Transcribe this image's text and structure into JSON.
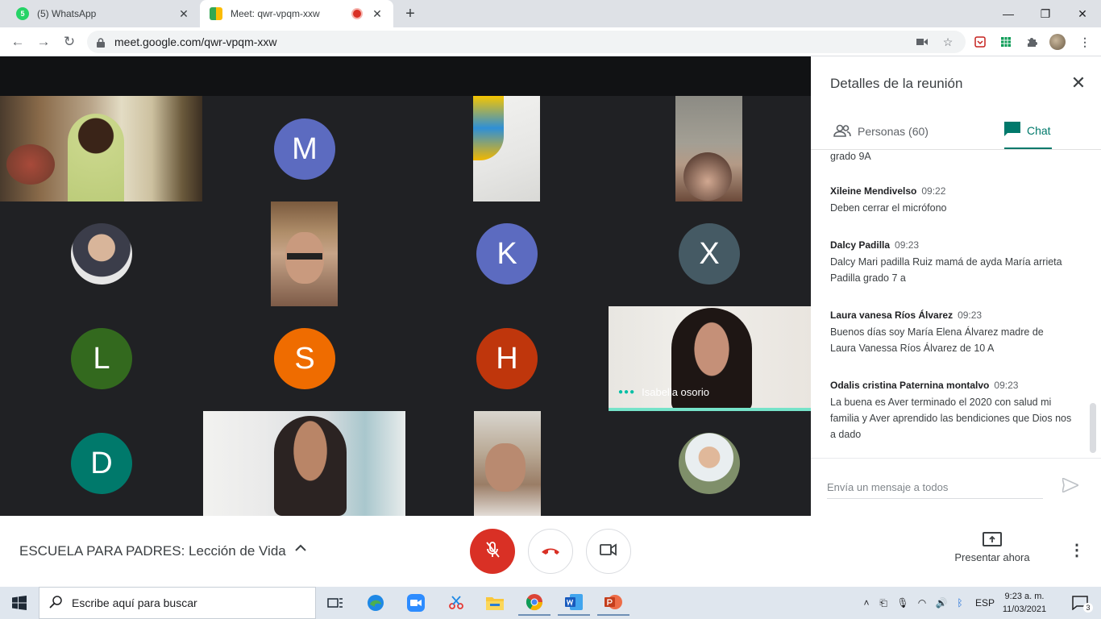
{
  "browser": {
    "tabs": [
      {
        "title": "(5) WhatsApp",
        "badge": "5",
        "active": false
      },
      {
        "title": "Meet: qwr-vpqm-xxw",
        "active": true,
        "recording": true
      }
    ],
    "url": "meet.google.com/qwr-vpqm-xxw"
  },
  "grid": {
    "tiles": [
      {
        "type": "video",
        "name": "participant-video-1"
      },
      {
        "type": "avatar",
        "letter": "M",
        "color": "#5c6bc0"
      },
      {
        "type": "video",
        "name": "participant-video-3"
      },
      {
        "type": "video",
        "name": "participant-video-4"
      },
      {
        "type": "photo",
        "name": "participant-photo-1"
      },
      {
        "type": "video",
        "name": "participant-video-5"
      },
      {
        "type": "avatar",
        "letter": "K",
        "color": "#5c6bc0"
      },
      {
        "type": "avatar",
        "letter": "X",
        "color": "#455a64"
      },
      {
        "type": "avatar",
        "letter": "L",
        "color": "#33691e"
      },
      {
        "type": "avatar",
        "letter": "S",
        "color": "#ef6c00"
      },
      {
        "type": "avatar",
        "letter": "H",
        "color": "#bf360c"
      },
      {
        "type": "video",
        "name": "Isabella osorio",
        "speaking": true
      },
      {
        "type": "avatar",
        "letter": "D",
        "color": "#00796b"
      },
      {
        "type": "video",
        "name": "participant-video-7"
      },
      {
        "type": "video",
        "name": "participant-video-8"
      },
      {
        "type": "photo",
        "name": "participant-photo-2"
      }
    ],
    "speaker_name": "Isabella osorio"
  },
  "panel": {
    "title": "Detalles de la reunión",
    "people_tab": "Personas (60)",
    "chat_tab": "Chat",
    "messages": [
      {
        "sender": "",
        "time": "",
        "text": "grado 9A"
      },
      {
        "sender": "Xileine Mendivelso",
        "time": "09:22",
        "text": "Deben cerrar el micrófono"
      },
      {
        "sender": "Dalcy Padilla",
        "time": "09:23",
        "text": "Dalcy Mari padilla Ruiz mamá de ayda María arrieta Padilla grado 7 a"
      },
      {
        "sender": "Laura vanesa Ríos Álvarez",
        "time": "09:23",
        "text": "Buenos días soy María Elena Álvarez madre de Laura Vanessa Ríos Álvarez de 10 A"
      },
      {
        "sender": "Odalis cristina Paternina montalvo",
        "time": "09:23",
        "text": "La buena es Aver terminado el 2020 con salud mi familia y Aver aprendido las bendiciones que Dios nos a dado"
      }
    ],
    "input_placeholder": "Envía un mensaje a todos"
  },
  "bottombar": {
    "meeting_name": "ESCUELA PARA PADRES: Lección de Vida",
    "present_label": "Presentar ahora"
  },
  "taskbar": {
    "search_placeholder": "Escribe aquí para buscar",
    "language": "ESP",
    "time": "9:23 a. m.",
    "date": "11/03/2021",
    "notifications": "3"
  }
}
